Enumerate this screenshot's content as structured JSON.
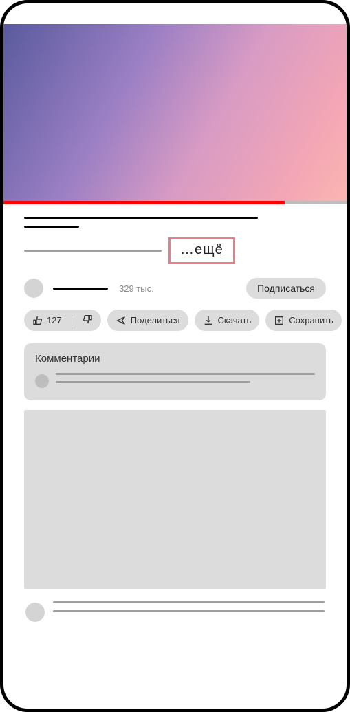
{
  "video": {
    "more_label": "…ещё"
  },
  "channel": {
    "sub_count": "329 тыс.",
    "subscribe_label": "Подписаться"
  },
  "chips": {
    "like_count": "127",
    "share_label": "Поделиться",
    "download_label": "Скачать",
    "save_label": "Сохранить"
  },
  "comments": {
    "title": "Комментарии"
  }
}
